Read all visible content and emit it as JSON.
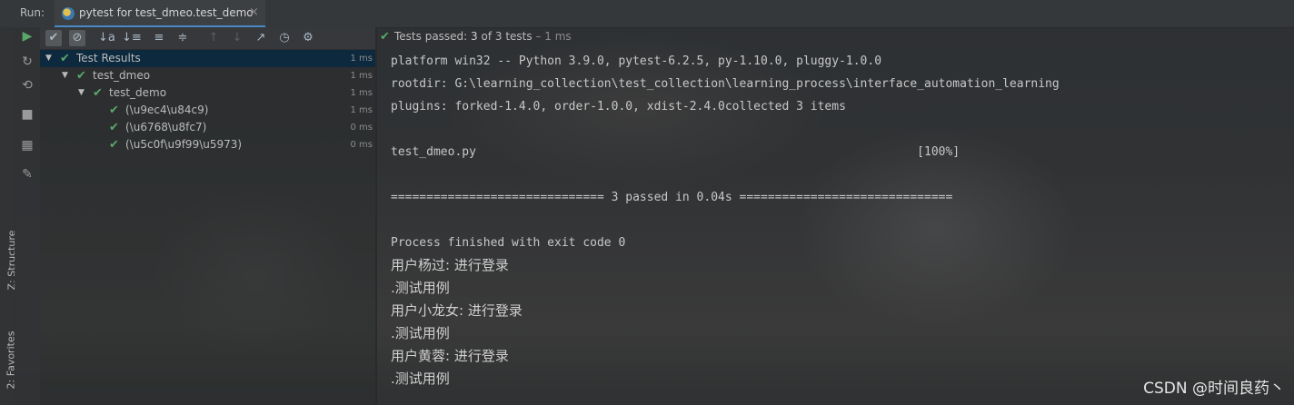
{
  "run_label": "Run:",
  "tab": {
    "title": "pytest for test_dmeo.test_demo",
    "close": "×"
  },
  "toolbar": {
    "buttons": [
      {
        "name": "rerun-icon",
        "glyph": "▶"
      },
      {
        "name": "show-passed-icon",
        "glyph": "✔"
      },
      {
        "name": "show-ignored-icon",
        "glyph": "⊘"
      },
      {
        "name": "sort-alpha-icon",
        "glyph": "↓a"
      },
      {
        "name": "sort-duration-icon",
        "glyph": "↓≡"
      },
      {
        "name": "expand-all-icon",
        "glyph": "≡"
      },
      {
        "name": "collapse-all-icon",
        "glyph": "≑"
      },
      {
        "name": "prev-test-icon",
        "glyph": "↑"
      },
      {
        "name": "next-test-icon",
        "glyph": "↓"
      },
      {
        "name": "export-icon",
        "glyph": "↗"
      },
      {
        "name": "history-icon",
        "glyph": "◷"
      },
      {
        "name": "settings-icon",
        "glyph": "⚙"
      }
    ]
  },
  "left_tools": [
    {
      "name": "rerun-failed-icon",
      "glyph": "↻"
    },
    {
      "name": "toggle-autotest-icon",
      "glyph": "⟲"
    },
    {
      "name": "stop-icon",
      "glyph": "■"
    },
    {
      "name": "layout-icon",
      "glyph": "▦"
    },
    {
      "name": "pin-icon",
      "glyph": "✎"
    }
  ],
  "side_tabs": {
    "structure": "Z: Structure",
    "favorites": "2: Favorites"
  },
  "status": {
    "prefix": "Tests passed: ",
    "count": "3",
    "suffix": " of 3 tests",
    "time": " – 1 ms"
  },
  "tree": [
    {
      "label": "Test Results",
      "duration": "1 ms",
      "level": 0,
      "expandable": true,
      "selected": true
    },
    {
      "label": "test_dmeo",
      "duration": "1 ms",
      "level": 1,
      "expandable": true,
      "selected": false
    },
    {
      "label": "test_demo",
      "duration": "1 ms",
      "level": 2,
      "expandable": true,
      "selected": false
    },
    {
      "label": "(\\u9ec4\\u84c9)",
      "duration": "1 ms",
      "level": 3,
      "expandable": false,
      "selected": false
    },
    {
      "label": "(\\u6768\\u8fc7)",
      "duration": "0 ms",
      "level": 3,
      "expandable": false,
      "selected": false
    },
    {
      "label": "(\\u5c0f\\u9f99\\u5973)",
      "duration": "0 ms",
      "level": 3,
      "expandable": false,
      "selected": false
    }
  ],
  "console": [
    {
      "text": "platform win32 -- Python 3.9.0, pytest-6.2.5, py-1.10.0, pluggy-1.0.0",
      "cjk": false
    },
    {
      "text": "rootdir: G:\\learning_collection\\test_collection\\learning_process\\interface_automation_learning",
      "cjk": false
    },
    {
      "text": "plugins: forked-1.4.0, order-1.0.0, xdist-2.4.0collected 3 items",
      "cjk": false
    },
    {
      "text": "",
      "cjk": false
    },
    {
      "text": "test_dmeo.py                                                              [100%]",
      "cjk": false
    },
    {
      "text": "",
      "cjk": false
    },
    {
      "text": "============================== 3 passed in 0.04s ==============================",
      "cjk": false
    },
    {
      "text": "",
      "cjk": false
    },
    {
      "text": "Process finished with exit code 0",
      "cjk": false
    },
    {
      "text": "用户杨过: 进行登录",
      "cjk": true
    },
    {
      "text": ".测试用例",
      "cjk": true
    },
    {
      "text": "用户小龙女: 进行登录",
      "cjk": true
    },
    {
      "text": ".测试用例",
      "cjk": true
    },
    {
      "text": "用户黄蓉: 进行登录",
      "cjk": true
    },
    {
      "text": ".测试用例",
      "cjk": true
    }
  ],
  "watermark": "CSDN @时间良药丶"
}
